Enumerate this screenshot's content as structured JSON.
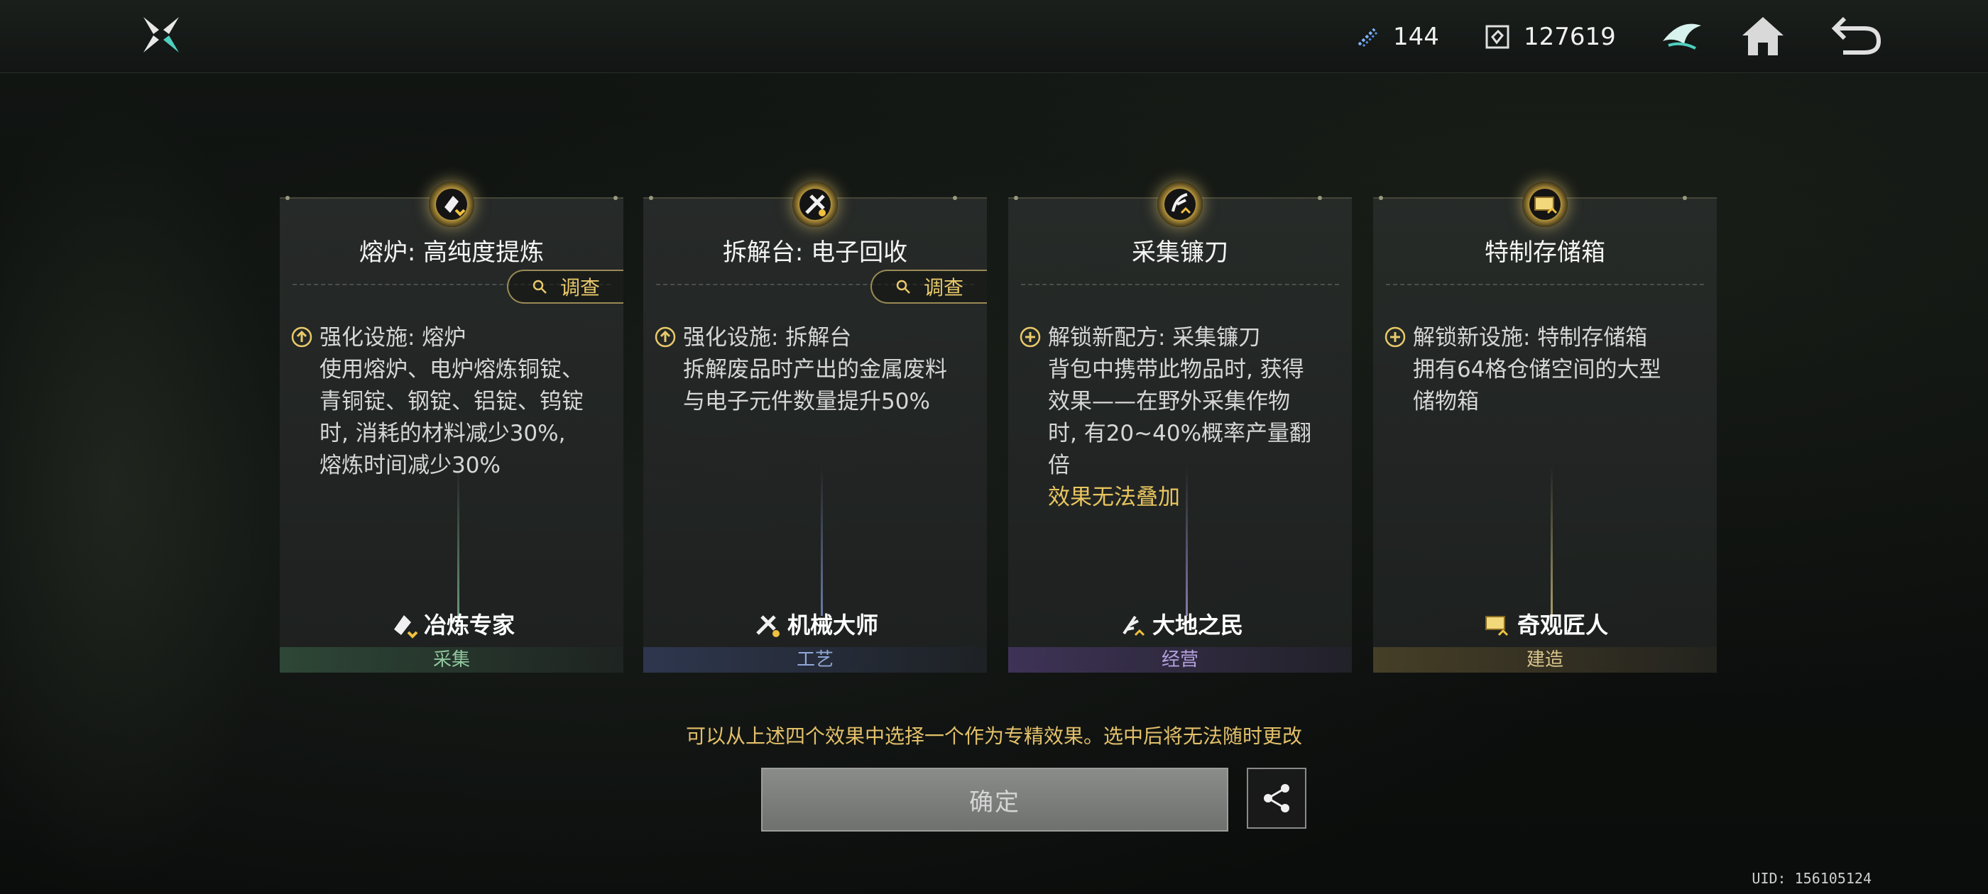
{
  "topbar": {
    "resources": [
      {
        "icon": "crystal-icon",
        "value": "144"
      },
      {
        "icon": "currency-icon",
        "value": "127619"
      }
    ],
    "nav": [
      "emblem-icon",
      "home-icon",
      "back-icon"
    ]
  },
  "cards": [
    {
      "title": "熔炉: 高纯度提炼",
      "investigate": "调查",
      "effect_icon": "upgrade-icon",
      "desc_lines": [
        "强化设施: 熔炉",
        "使用熔炉、电炉熔炼铜锭、",
        "青铜锭、钢锭、铝锭、钨锭",
        "时, 消耗的材料减少30%,",
        "熔炼时间减少30%"
      ],
      "note": "",
      "specialist": "冶炼专家",
      "category": "采集",
      "accent": "#8fc79d"
    },
    {
      "title": "拆解台: 电子回收",
      "investigate": "调查",
      "effect_icon": "upgrade-icon",
      "desc_lines": [
        "强化设施: 拆解台",
        "拆解废品时产出的金属废料",
        "与电子元件数量提升50%"
      ],
      "note": "",
      "specialist": "机械大师",
      "category": "工艺",
      "accent": "#90a8d8"
    },
    {
      "title": "采集镰刀",
      "investigate": "",
      "effect_icon": "unlock-icon",
      "desc_lines": [
        "解锁新配方: 采集镰刀",
        "背包中携带此物品时, 获得",
        "效果——在野外采集作物",
        "时, 有20~40%概率产量翻",
        "倍"
      ],
      "note": "效果无法叠加",
      "specialist": "大地之民",
      "category": "经营",
      "accent": "#b6a2e0"
    },
    {
      "title": "特制存储箱",
      "investigate": "",
      "effect_icon": "unlock-icon",
      "desc_lines": [
        "解锁新设施: 特制存储箱",
        "拥有64格仓储空间的大型",
        "储物箱"
      ],
      "note": "",
      "specialist": "奇观匠人",
      "category": "建造",
      "accent": "#d8c48c"
    }
  ],
  "hint": "可以从上述四个效果中选择一个作为专精效果。选中后将无法随时更改",
  "confirm_label": "确定",
  "uid": "UID: 156105124"
}
